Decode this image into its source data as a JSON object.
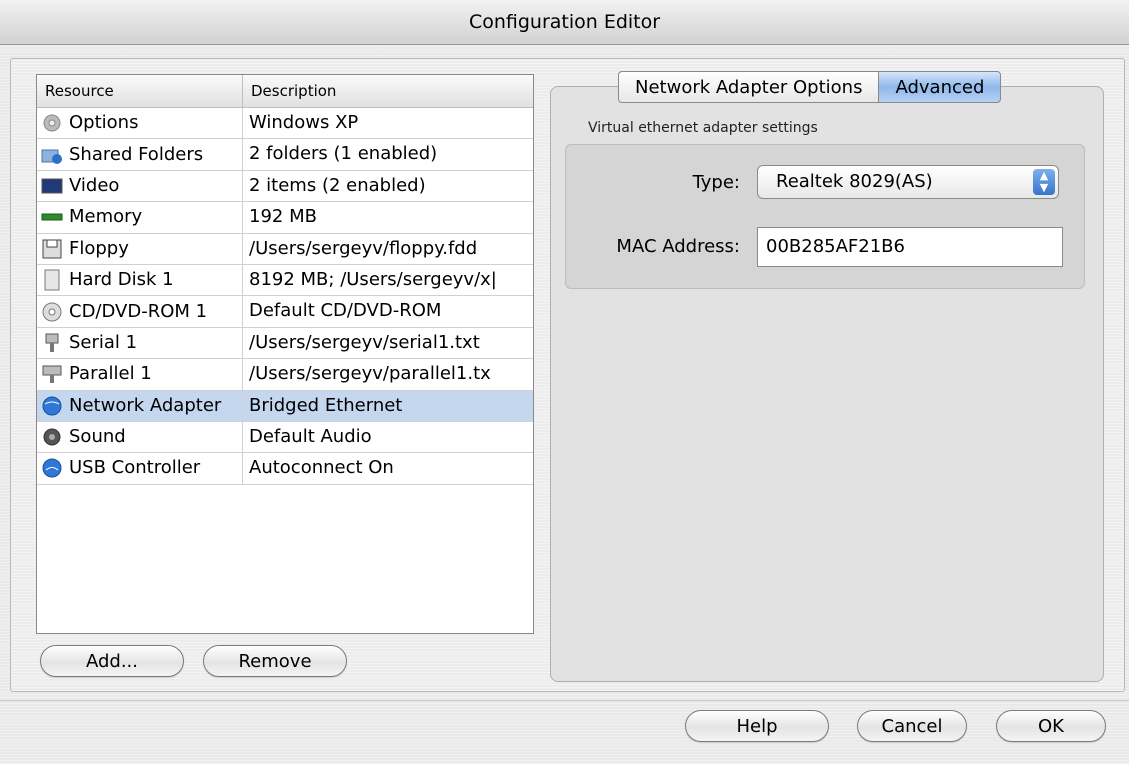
{
  "window": {
    "title": "Configuration Editor"
  },
  "table": {
    "headers": [
      "Resource",
      "Description"
    ],
    "rows": [
      {
        "icon": "gear-icon",
        "resource": "Options",
        "description": "Windows XP"
      },
      {
        "icon": "shared-folder-icon",
        "resource": "Shared Folders",
        "description": "2 folders (1 enabled)"
      },
      {
        "icon": "monitor-icon",
        "resource": "Video",
        "description": "2 items (2 enabled)"
      },
      {
        "icon": "memory-icon",
        "resource": "Memory",
        "description": "192 MB"
      },
      {
        "icon": "floppy-icon",
        "resource": "Floppy",
        "description": "/Users/sergeyv/floppy.fdd"
      },
      {
        "icon": "hard-disk-icon",
        "resource": "Hard Disk 1",
        "description": "8192 MB; /Users/sergeyv/x|"
      },
      {
        "icon": "cd-icon",
        "resource": "CD/DVD-ROM 1",
        "description": "Default CD/DVD-ROM"
      },
      {
        "icon": "serial-port-icon",
        "resource": "Serial 1",
        "description": "/Users/sergeyv/serial1.txt"
      },
      {
        "icon": "parallel-port-icon",
        "resource": "Parallel 1",
        "description": "/Users/sergeyv/parallel1.tx"
      },
      {
        "icon": "network-globe-icon",
        "resource": "Network Adapter",
        "description": "Bridged Ethernet",
        "selected": true
      },
      {
        "icon": "speaker-icon",
        "resource": "Sound",
        "description": "Default Audio"
      },
      {
        "icon": "usb-globe-icon",
        "resource": "USB Controller",
        "description": "Autoconnect On"
      }
    ]
  },
  "buttons": {
    "add": "Add...",
    "remove": "Remove",
    "help": "Help",
    "cancel": "Cancel",
    "ok": "OK"
  },
  "tabs": {
    "options": "Network Adapter Options",
    "advanced": "Advanced",
    "active": "Advanced"
  },
  "settings": {
    "group_label": "Virtual ethernet adapter settings",
    "type_label": "Type:",
    "type_value": "Realtek 8029(AS)",
    "mac_label": "MAC Address:",
    "mac_value": "00B285AF21B6"
  },
  "colors": {
    "selection": "#c4d7ef",
    "accent": "#3574cc"
  }
}
